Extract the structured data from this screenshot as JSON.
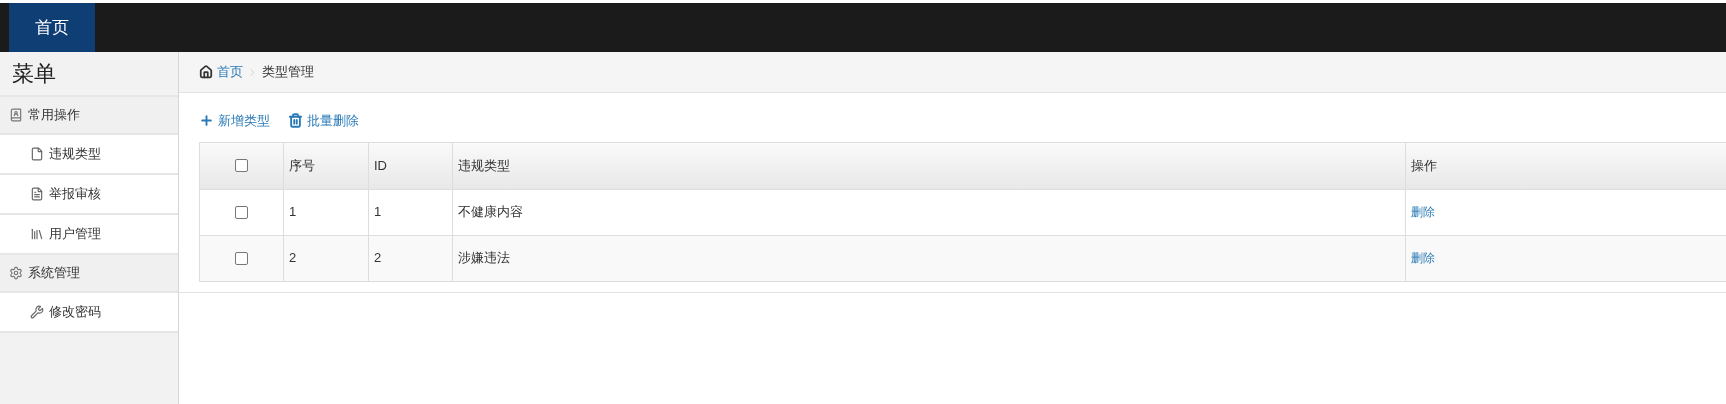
{
  "top_nav": {
    "tabs": [
      {
        "label": "首页",
        "selected": true
      }
    ]
  },
  "sidebar": {
    "title": "菜单",
    "groups": [
      {
        "label": "常用操作",
        "kind": "card",
        "children": [
          {
            "label": "违规类型",
            "kind": "file"
          },
          {
            "label": "举报审核",
            "kind": "list"
          },
          {
            "label": "用户管理",
            "kind": "books"
          }
        ]
      },
      {
        "label": "系统管理",
        "kind": "gear",
        "children": [
          {
            "label": "修改密码",
            "kind": "wrench"
          }
        ]
      }
    ]
  },
  "breadcrumb": [
    {
      "label": "首页",
      "kind": "link"
    },
    {
      "label": "类型管理",
      "kind": "current"
    }
  ],
  "toolbar": [
    {
      "label": "新增类型",
      "kind": "plus"
    },
    {
      "label": "批量删除",
      "kind": "trash"
    }
  ],
  "table": {
    "header_checked": false,
    "columns": [
      "序号",
      "ID",
      "违规类型",
      "操作"
    ],
    "rows": [
      {
        "checked": false,
        "cells": [
          "1",
          "1",
          "不健康内容"
        ],
        "action": "删除"
      },
      {
        "checked": false,
        "cells": [
          "2",
          "2",
          "涉嫌违法"
        ],
        "action": "删除"
      }
    ]
  }
}
